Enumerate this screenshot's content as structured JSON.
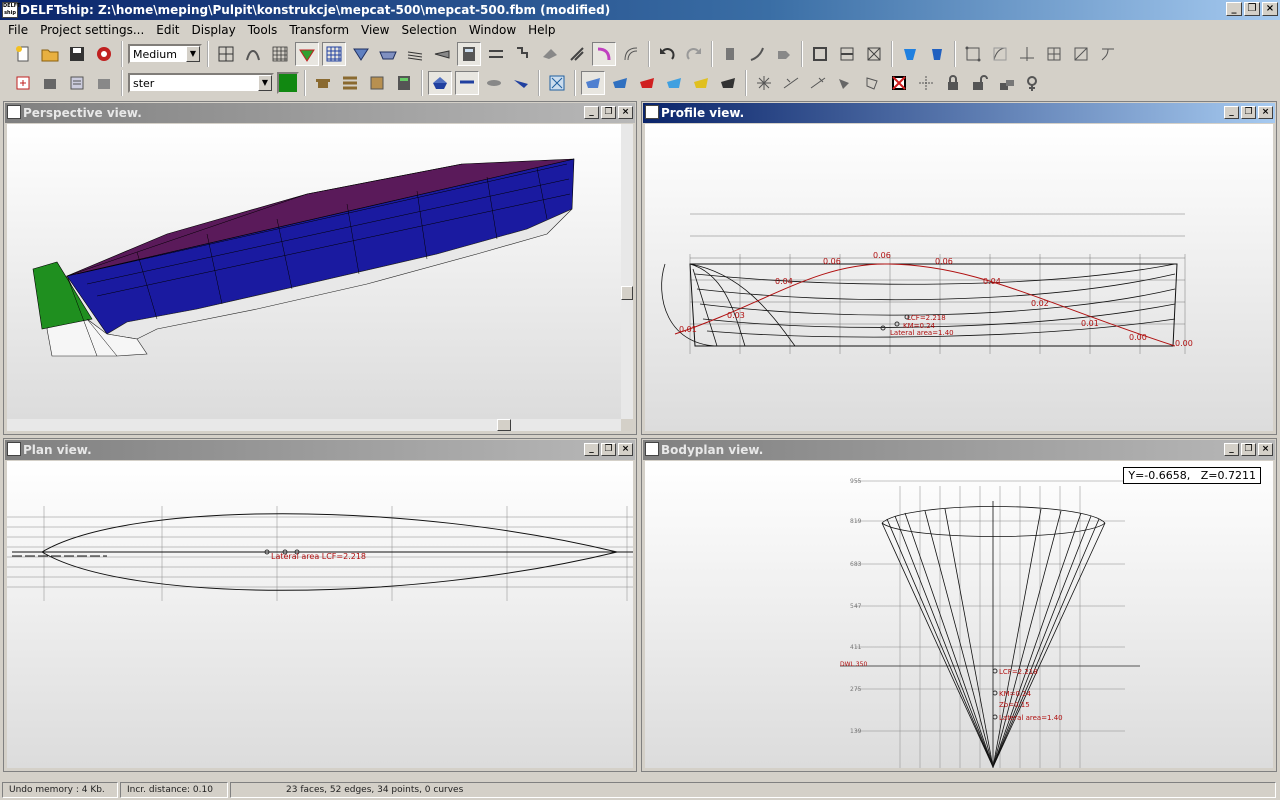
{
  "app": {
    "title": "DELFTship: Z:\\home\\meping\\Pulpit\\konstrukcje\\mepcat-500\\mepcat-500.fbm (modified)",
    "icon_text": "DELFT ship",
    "window_buttons": [
      "_",
      "❐",
      "×"
    ]
  },
  "menu": [
    "File",
    "Project settings...",
    "Edit",
    "Display",
    "Tools",
    "Transform",
    "View",
    "Selection",
    "Window",
    "Help"
  ],
  "toolbar": {
    "precision": "Medium",
    "layer_name": "ster",
    "layer_color": "#118811",
    "row1_icons": [
      "new-file-icon",
      "open-folder-icon",
      "save-disk-icon",
      "help-lifebuoy-icon",
      "precision-dropdown",
      "grid-icon",
      "curvature-icon",
      "control-net-icon",
      "interior-edges-icon",
      "gridlines-icon",
      "stations-icon",
      "buttocks-icon",
      "waterlines-icon",
      "diagonals-icon",
      "hydrostatics-calculator-icon",
      "intersect-icon",
      "flowlines-icon",
      "markers-icon",
      "zebra-icon",
      "curvature-plot-icon",
      "undo-icon",
      "redo-icon",
      "edge-split-icon",
      "edge-collapse-icon",
      "new-edge-icon",
      "point-collapse-icon",
      "face-new-icon",
      "face-invert-icon",
      "lackenby-icon",
      "hull-icon",
      "shade-icon",
      "zoom-all-icon",
      "zoom-in-icon",
      "zoom-out-icon",
      "rotate-icon",
      "move-icon"
    ],
    "row2_icons": [
      "new-layer-icon",
      "delete-layer-icon",
      "layer-properties-icon",
      "color-swatch",
      "layer-auto-group-icon",
      "layer-stack-icon",
      "layer-box-icon",
      "layer-calc-icon",
      "shade-hull-icon",
      "shade-gauss-icon",
      "shade-developable-icon",
      "shade-zebra-icon",
      "import-select-icon",
      "select-all-icon",
      "deselect-icon",
      "select-red-icon",
      "select-blue-icon",
      "select-yellow-icon",
      "select-dark-icon",
      "point-new-icon",
      "point-align-icon",
      "point-intersect-icon",
      "point-lock-icon",
      "point-unlock-icon",
      "point-unlock-all-icon",
      "point-extrude-icon",
      "point-move-icon"
    ]
  },
  "viewports": {
    "perspective": {
      "title": "Perspective view."
    },
    "profile": {
      "title": "Profile view.",
      "curve_labels": [
        "0.01",
        "0.03",
        "0.04",
        "0.06",
        "0.06",
        "0.06",
        "0.04",
        "0.02",
        "0.01",
        "0.00",
        "0.00"
      ],
      "annotations": [
        "LCF=2.218",
        "KM=0.24",
        "Lateral area=1.40"
      ]
    },
    "plan": {
      "title": "Plan view.",
      "annotations": [
        "Lateral area LCF=2.218"
      ]
    },
    "bodyplan": {
      "title": "Bodyplan view.",
      "coordinates": "Y=-0.6658,   Z=0.7211",
      "waterline_labels": [
        "955",
        "819",
        "683",
        "547",
        "411",
        "DWL 350",
        "275",
        "139"
      ],
      "annotations": [
        "LCF=2.218",
        "KM=0.24",
        "Zb=0.15",
        "Lateral area=1.40"
      ]
    }
  },
  "status": {
    "undo": "Undo memory : 4 Kb.",
    "incr": "Incr. distance: 0.10",
    "info": "23 faces, 52 edges, 34 points, 0 curves"
  },
  "colors": {
    "hull_deck": "#5a1a5a",
    "hull_side": "#1a1aa0",
    "hull_bottom": "#f2f2f2",
    "transom": "#1f8f1f",
    "curve_red": "#b01010",
    "active_title": "#0a246a"
  }
}
